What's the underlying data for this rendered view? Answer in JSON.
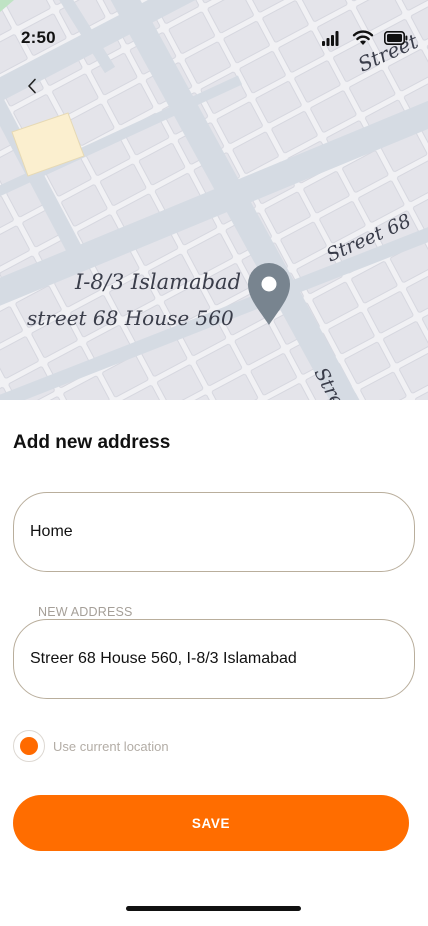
{
  "status_bar": {
    "time": "2:50"
  },
  "map": {
    "area_label": "I-8/3 Islamabad",
    "address_label": "street 68 House 560",
    "street_labels": [
      "Street",
      "Street 68",
      "Stre"
    ]
  },
  "sheet": {
    "title": "Add new address",
    "name_field": {
      "value": "Home"
    },
    "address_field": {
      "label": "NEW ADDRESS",
      "value": "Streer 68 House 560, I-8/3 Islamabad"
    },
    "use_current_location": {
      "label": "Use current location",
      "checked": true
    },
    "save_label": "SAVE"
  },
  "colors": {
    "accent": "#ff6d00",
    "field_border": "#b9ae9c",
    "muted_text": "#b3ada6",
    "map_background": "#f1f1f4",
    "map_road": "#d5dbe3",
    "map_pin": "#78848f"
  },
  "icons": {
    "back": "chevron-left-icon",
    "signal": "cellular-signal-icon",
    "wifi": "wifi-icon",
    "battery": "battery-icon",
    "pin": "map-pin-icon"
  }
}
